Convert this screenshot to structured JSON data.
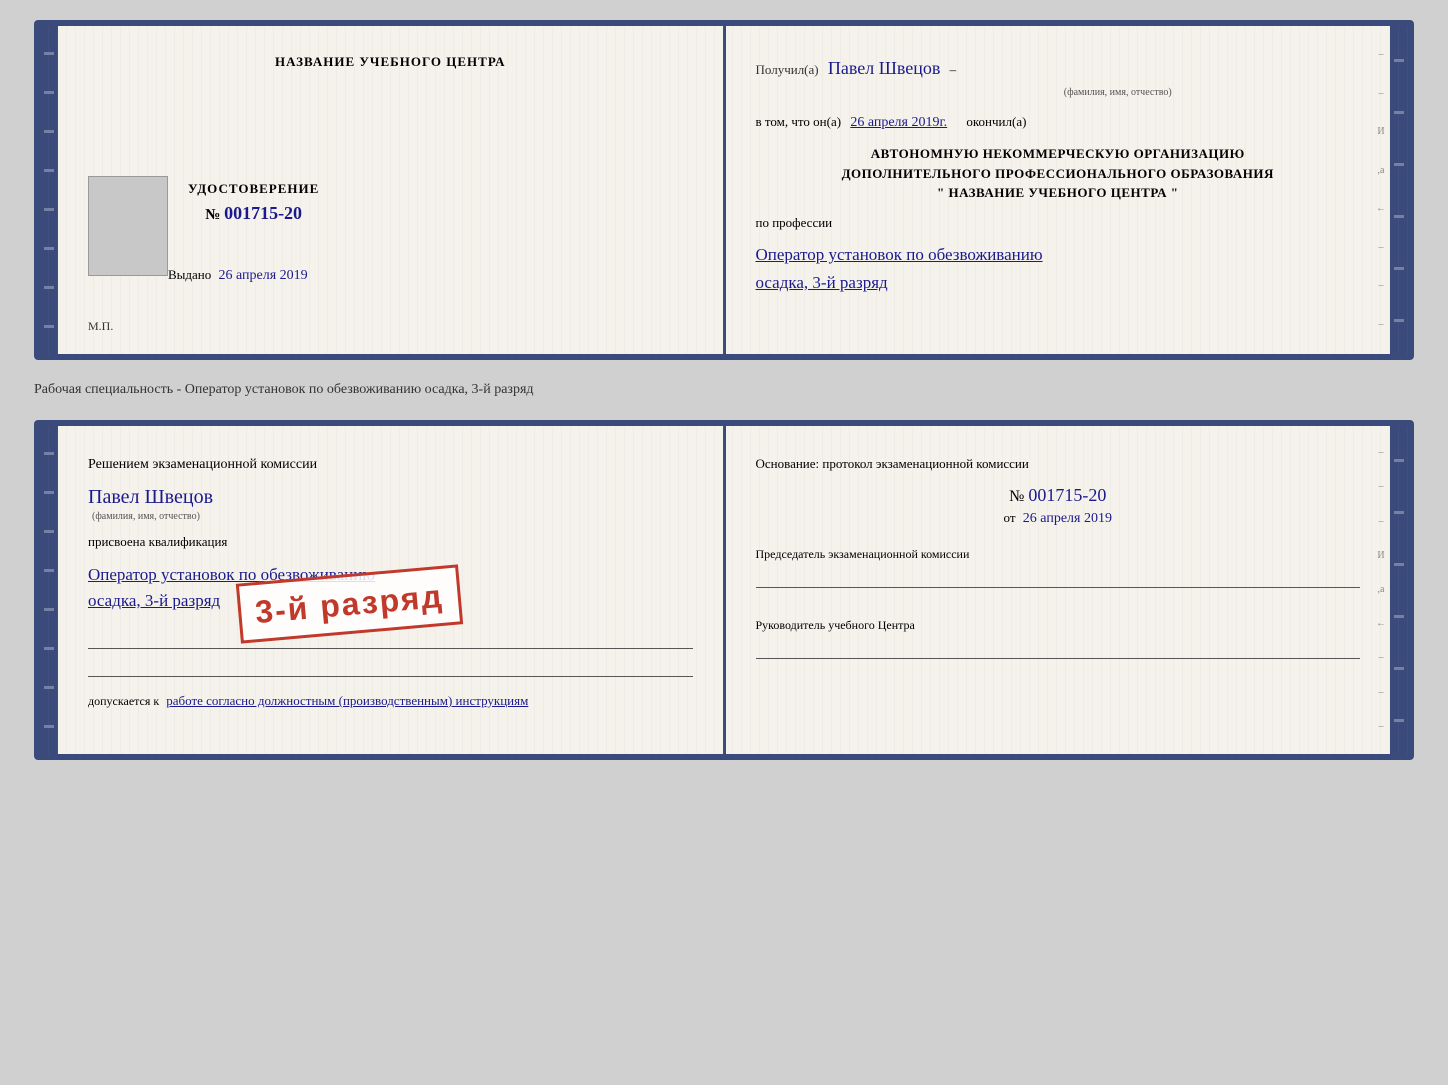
{
  "document1": {
    "left": {
      "title_center": "НАЗВАНИЕ УЧЕБНОГО ЦЕНТРА",
      "cert_label": "УДОСТОВЕРЕНИЕ",
      "cert_number_prefix": "№",
      "cert_number": "001715-20",
      "issued_label": "Выдано",
      "issued_date": "26 апреля 2019",
      "mp_label": "М.П."
    },
    "right": {
      "received_label": "Получил(а)",
      "received_name": "Павел Швецов",
      "fio_sublabel": "(фамилия, имя, отчество)",
      "dash": "–",
      "in_that_label": "в том, что он(а)",
      "date_value": "26 апреля 2019г.",
      "finished_label": "окончил(а)",
      "org_line1": "АВТОНОМНУЮ НЕКОММЕРЧЕСКУЮ ОРГАНИЗАЦИЮ",
      "org_line2": "ДОПОЛНИТЕЛЬНОГО ПРОФЕССИОНАЛЬНОГО ОБРАЗОВАНИЯ",
      "org_quote_open": "\"",
      "org_name": "НАЗВАНИЕ УЧЕБНОГО ЦЕНТРА",
      "org_quote_close": "\"",
      "by_profession_label": "по профессии",
      "profession_line1": "Оператор установок по обезвоживанию",
      "profession_line2": "осадка, 3-й разряд"
    }
  },
  "separator": {
    "text": "Рабочая специальность - Оператор установок по обезвоживанию осадка, 3-й разряд"
  },
  "document2": {
    "left": {
      "decision_label": "Решением экзаменационной комиссии",
      "person_name": "Павел Швецов",
      "fio_sublabel": "(фамилия, имя, отчество)",
      "qualification_label": "присвоена квалификация",
      "profession_line1": "Оператор установок по обезвоживанию",
      "profession_line2": "осадка, 3-й разряд",
      "allowed_label": "допускается к",
      "allowed_value": "работе согласно должностным (производственным) инструкциям"
    },
    "right": {
      "basis_label": "Основание: протокол экзаменационной комиссии",
      "number_prefix": "№",
      "number_value": "001715-20",
      "date_prefix": "от",
      "date_value": "26 апреля 2019",
      "chairman_label": "Председатель экзаменационной комиссии",
      "head_label": "Руководитель учебного Центра"
    },
    "stamp": {
      "line1": "3-й разряд"
    }
  }
}
